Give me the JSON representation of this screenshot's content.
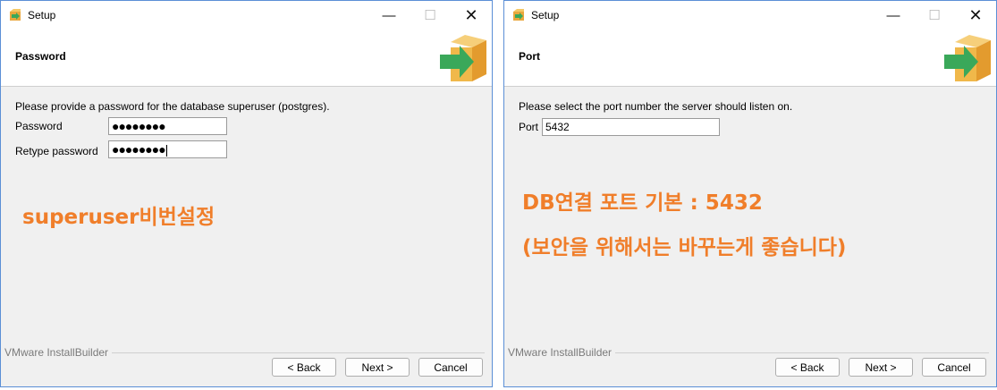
{
  "windows": [
    {
      "title": "Setup",
      "header": "Password",
      "description": "Please provide a password for the database superuser (postgres).",
      "fields": [
        {
          "label": "Password",
          "value": "●●●●●●●●"
        },
        {
          "label": "Retype password",
          "value": "●●●●●●●●|"
        }
      ],
      "annotation_lines": [
        "superuser비번설정"
      ],
      "brand": "VMware InstallBuilder",
      "buttons": {
        "back": "< Back",
        "next": "Next >",
        "cancel": "Cancel"
      }
    },
    {
      "title": "Setup",
      "header": "Port",
      "description": "Please select the port number the server should listen on.",
      "fields": [
        {
          "label": "Port",
          "value": "5432"
        }
      ],
      "annotation_lines": [
        "DB연결 포트 기본 : 5432",
        "(보안을 위해서는 바꾸는게 좋습니다)"
      ],
      "brand": "VMware InstallBuilder",
      "buttons": {
        "back": "< Back",
        "next": "Next >",
        "cancel": "Cancel"
      }
    }
  ],
  "titlebar_controls": {
    "minimize": "—",
    "maximize": "☐",
    "close": "✕"
  },
  "colors": {
    "annotation": "#f07e2a",
    "window_border": "#5b8fd6",
    "logo_box": "#f0b84a",
    "logo_arrow": "#3aa85a"
  }
}
